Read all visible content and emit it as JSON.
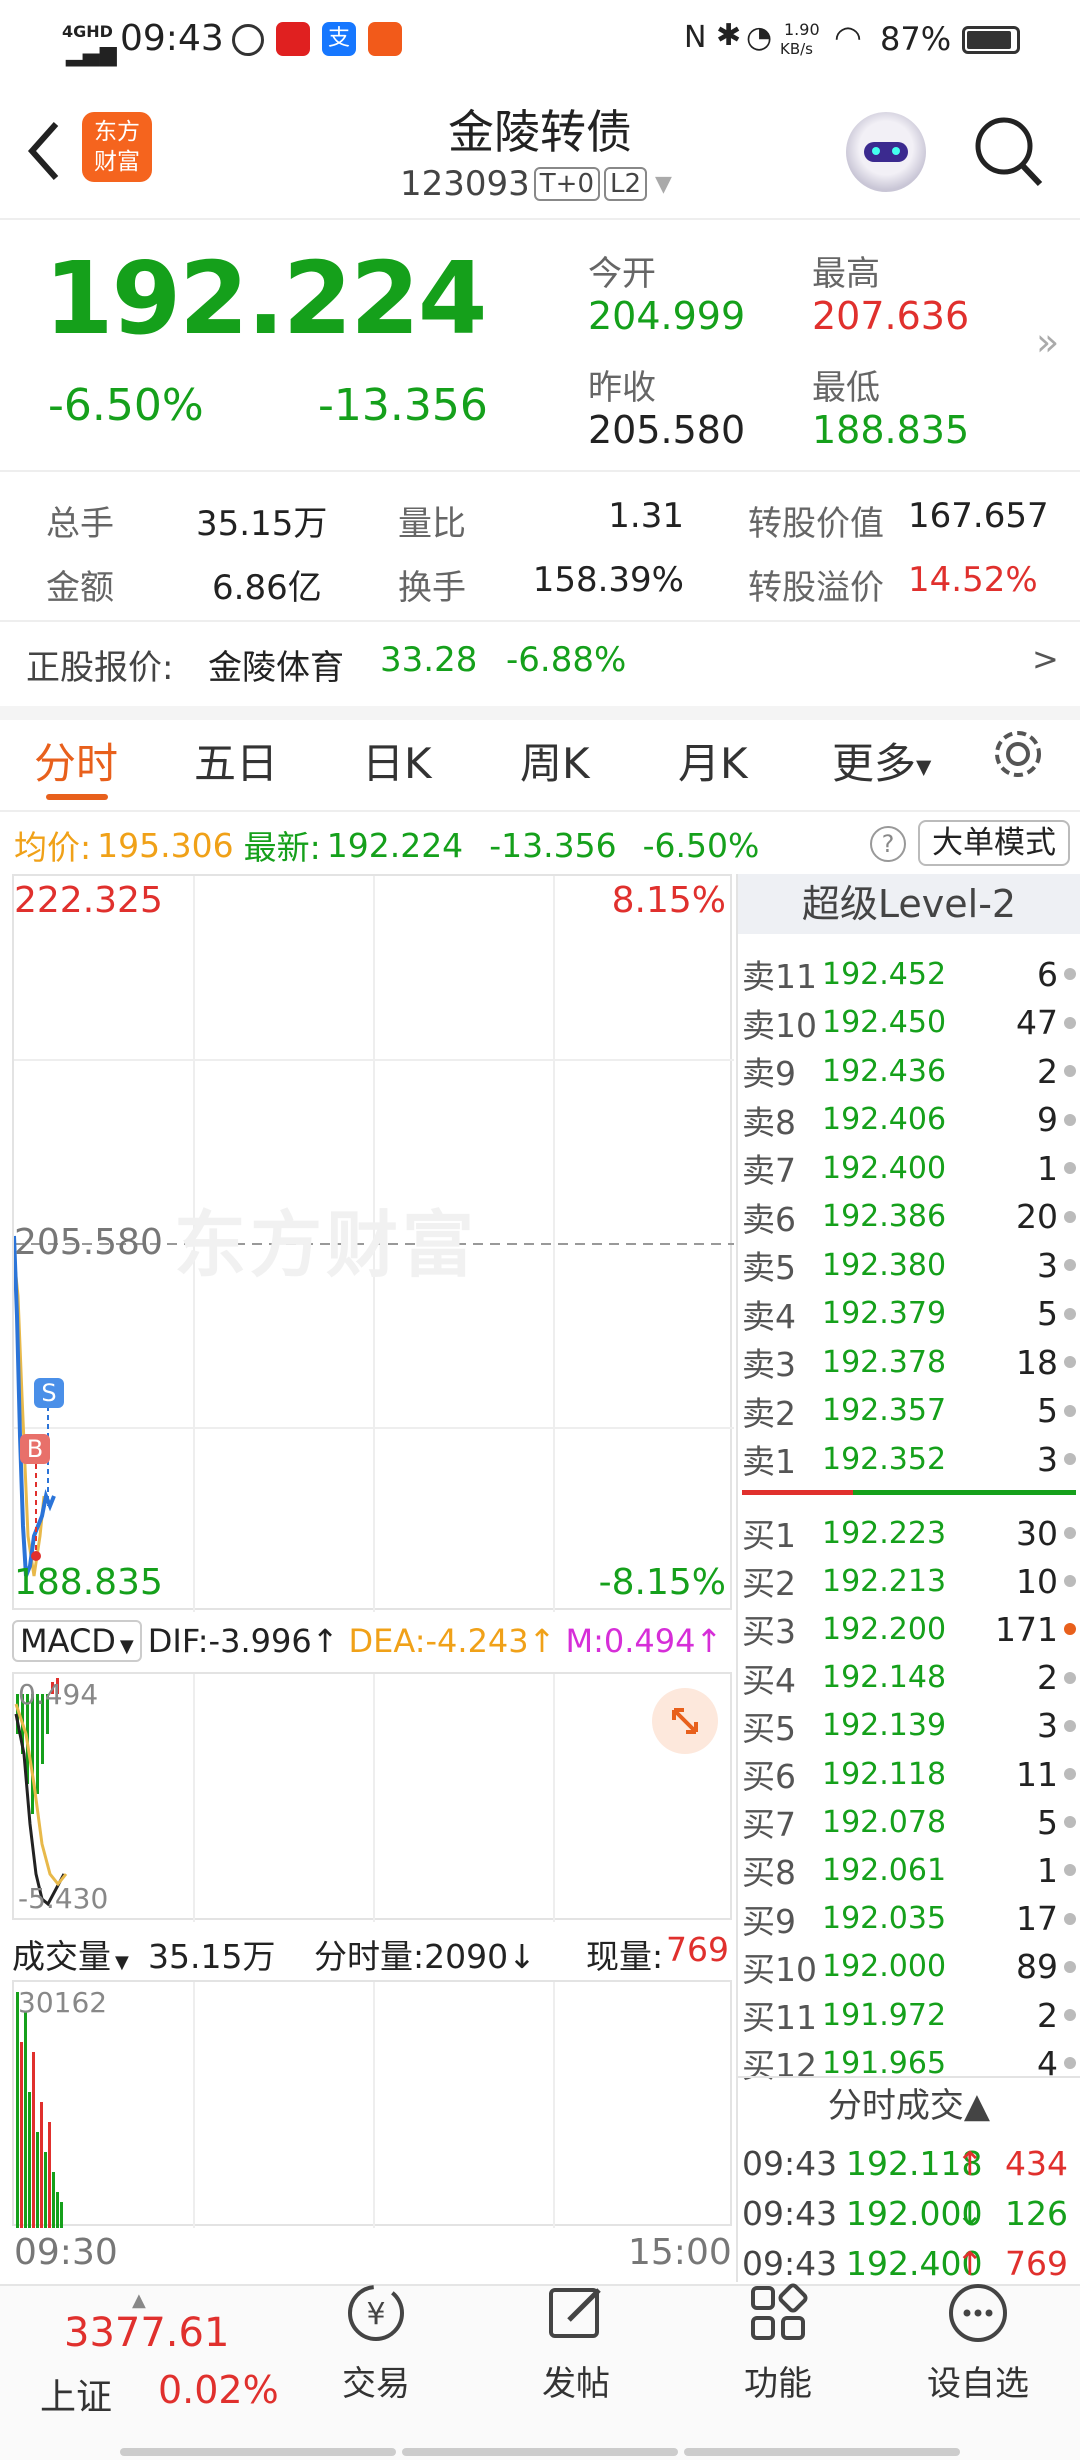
{
  "status": {
    "network": "4GHD",
    "time": "09:43",
    "speed_value": "1.90",
    "speed_unit": "KB/s",
    "battery": "87%"
  },
  "header": {
    "logo_line1": "东方",
    "logo_line2": "财富",
    "title": "金陵转债",
    "code": "123093",
    "badge1": "T+0",
    "badge2": "L2"
  },
  "quote": {
    "price": "192.224",
    "change_pct": "-6.50%",
    "change": "-13.356",
    "open_label": "今开",
    "open": "204.999",
    "high_label": "最高",
    "high": "207.636",
    "prev_label": "昨收",
    "prev": "205.580",
    "low_label": "最低",
    "low": "188.835"
  },
  "stats": {
    "vol_label": "总手",
    "vol": "35.15万",
    "vr_label": "量比",
    "vr": "1.31",
    "cv_label": "转股价值",
    "cv": "167.657",
    "amt_label": "金额",
    "amt": "6.86亿",
    "turn_label": "换手",
    "turn": "158.39%",
    "prem_label": "转股溢价",
    "prem": "14.52%"
  },
  "stock": {
    "label": "正股报价:",
    "name": "金陵体育",
    "price": "33.28",
    "change": "-6.88%",
    "arrow": ">"
  },
  "tabs": [
    "分时",
    "五日",
    "日K",
    "周K",
    "月K",
    "更多"
  ],
  "avg_bar": {
    "avg_label": "均价:",
    "avg": "195.306",
    "latest_label": "最新:",
    "latest": "192.224",
    "change": "-13.356",
    "pct": "-6.50%",
    "help": "?",
    "mode_button": "大单模式"
  },
  "intraday": {
    "max_price": "222.325",
    "max_pct": "8.15%",
    "ref_price": "205.580",
    "min_price": "188.835",
    "min_pct": "-8.15%",
    "watermark": "东方财富",
    "marker_s": "S",
    "marker_b": "B"
  },
  "macd": {
    "label": "MACD",
    "dif": "DIF:-3.996↑",
    "dea": "DEA:-4.243↑",
    "m": "M:0.494↑",
    "top": "0.494",
    "bottom": "-5.430"
  },
  "volume": {
    "label": "成交量",
    "total": "35.15万",
    "tick": "分时量:2090↓",
    "now_label": "现量:",
    "now": "769",
    "max": "30162",
    "time_start": "09:30",
    "time_end": "15:00"
  },
  "orderbook": {
    "title": "超级Level-2",
    "asks": [
      {
        "label": "卖11",
        "price": "192.452",
        "qty": "6"
      },
      {
        "label": "卖10",
        "price": "192.450",
        "qty": "47"
      },
      {
        "label": "卖9",
        "price": "192.436",
        "qty": "2"
      },
      {
        "label": "卖8",
        "price": "192.406",
        "qty": "9"
      },
      {
        "label": "卖7",
        "price": "192.400",
        "qty": "1"
      },
      {
        "label": "卖6",
        "price": "192.386",
        "qty": "20"
      },
      {
        "label": "卖5",
        "price": "192.380",
        "qty": "3"
      },
      {
        "label": "卖4",
        "price": "192.379",
        "qty": "5"
      },
      {
        "label": "卖3",
        "price": "192.378",
        "qty": "18"
      },
      {
        "label": "卖2",
        "price": "192.357",
        "qty": "5"
      },
      {
        "label": "卖1",
        "price": "192.352",
        "qty": "3"
      }
    ],
    "bids": [
      {
        "label": "买1",
        "price": "192.223",
        "qty": "30"
      },
      {
        "label": "买2",
        "price": "192.213",
        "qty": "10"
      },
      {
        "label": "买3",
        "price": "192.200",
        "qty": "171"
      },
      {
        "label": "买4",
        "price": "192.148",
        "qty": "2"
      },
      {
        "label": "买5",
        "price": "192.139",
        "qty": "3"
      },
      {
        "label": "买6",
        "price": "192.118",
        "qty": "11"
      },
      {
        "label": "买7",
        "price": "192.078",
        "qty": "5"
      },
      {
        "label": "买8",
        "price": "192.061",
        "qty": "1"
      },
      {
        "label": "买9",
        "price": "192.035",
        "qty": "17"
      },
      {
        "label": "买10",
        "price": "192.000",
        "qty": "89"
      },
      {
        "label": "买11",
        "price": "191.972",
        "qty": "2"
      },
      {
        "label": "买12",
        "price": "191.965",
        "qty": "4"
      }
    ],
    "trades_title": "分时成交▲",
    "trades": [
      {
        "time": "09:43",
        "price": "192.118",
        "dir": "↑",
        "qty": "434"
      },
      {
        "time": "09:43",
        "price": "192.000",
        "dir": "↓",
        "qty": "126"
      },
      {
        "time": "09:43",
        "price": "192.400",
        "dir": "↑",
        "qty": "769"
      }
    ]
  },
  "bottom_nav": {
    "index_value": "3377.61",
    "index_name": "上证",
    "index_change": "0.02%",
    "items": [
      "交易",
      "发帖",
      "功能",
      "设自选"
    ]
  }
}
